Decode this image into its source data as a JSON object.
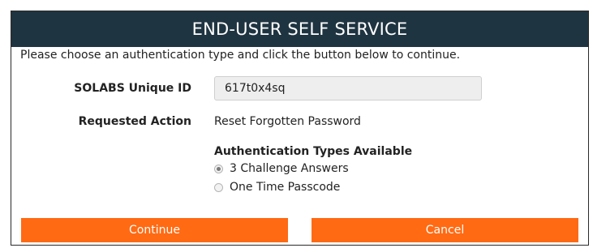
{
  "header": {
    "title": "END-USER SELF SERVICE"
  },
  "instructions": "Please choose an authentication type and click the button below to continue.",
  "form": {
    "unique_id_label": "SOLABS Unique ID",
    "unique_id_value": "617t0x4sq",
    "requested_action_label": "Requested Action",
    "requested_action_value": "Reset Forgotten Password",
    "auth_types_title": "Authentication Types Available",
    "auth_types": [
      {
        "label": "3 Challenge Answers",
        "selected": true
      },
      {
        "label": "One Time Passcode",
        "selected": false
      }
    ]
  },
  "buttons": {
    "continue_label": "Continue",
    "cancel_label": "Cancel"
  },
  "colors": {
    "header_bg": "#1f3441",
    "button_bg": "#ff6a13"
  }
}
